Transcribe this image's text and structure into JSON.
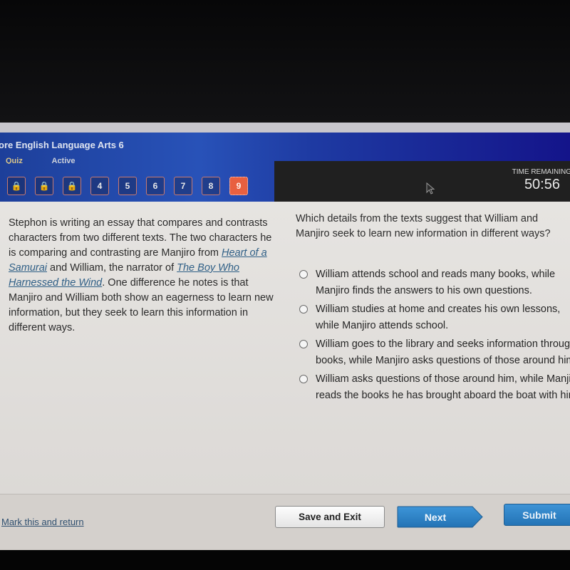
{
  "header": {
    "course_title": "ore English Language Arts 6",
    "sub_labels": [
      "Quiz",
      "Active"
    ],
    "question_nav": [
      {
        "label": "",
        "state": "locked",
        "icon": "lock-icon"
      },
      {
        "label": "",
        "state": "locked",
        "icon": "lock-icon"
      },
      {
        "label": "",
        "state": "locked",
        "icon": "lock-icon"
      },
      {
        "label": "4",
        "state": "available"
      },
      {
        "label": "5",
        "state": "available"
      },
      {
        "label": "6",
        "state": "available"
      },
      {
        "label": "7",
        "state": "available"
      },
      {
        "label": "8",
        "state": "available"
      },
      {
        "label": "9",
        "state": "current"
      }
    ],
    "time_remaining_label": "TIME REMAINING",
    "time_remaining_value": "50:56"
  },
  "passage": {
    "part1": "Stephon is writing an essay that compares and contrasts characters from two different texts. The two characters he is comparing and contrasting are Manjiro from ",
    "title1": "Heart of a Samurai",
    "part2": " and William, the narrator of ",
    "title2": "The Boy Who Harnessed the Wind",
    "part3": ". One difference he notes is that Manjiro and William both show an eagerness to learn new information, but they seek to learn this information in different ways."
  },
  "question": {
    "prompt": "Which details from the texts suggest that William and Manjiro seek to learn new information in different ways?",
    "choices": [
      "William attends school and reads many books, while Manjiro finds the answers to his own questions.",
      "William studies at home and creates his own lessons, while Manjiro attends school.",
      "William goes to the library and seeks information through books, while Manjiro asks questions of those around him.",
      "William asks questions of those around him, while Manjiro reads the books he has brought aboard the boat with him."
    ]
  },
  "footer": {
    "mark_link": "Mark this and return",
    "save_exit": "Save and Exit",
    "next": "Next",
    "submit": "Submit"
  },
  "colors": {
    "header_blue": "#2852b8",
    "current_question": "#e86040",
    "button_blue": "#2a7cc0"
  }
}
